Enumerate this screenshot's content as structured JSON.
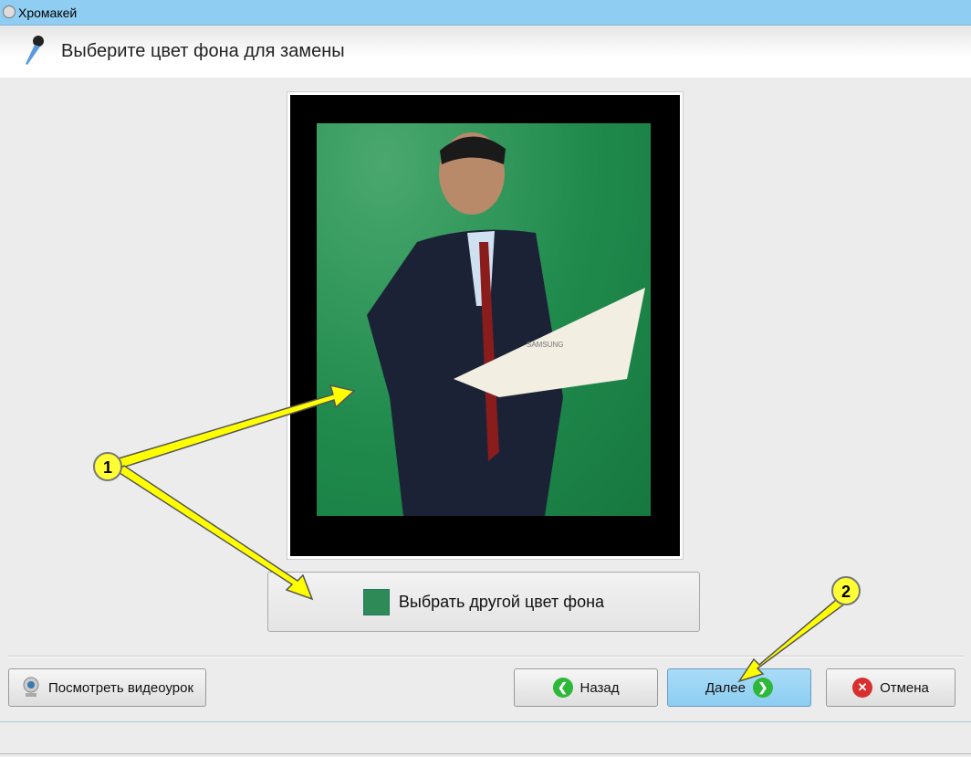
{
  "window": {
    "title": "Хромакей",
    "icon": "film-reel-icon"
  },
  "header": {
    "title": "Выберите цвет фона для замены",
    "icon": "pipette-icon"
  },
  "preview": {
    "background_color": "#1f8a4c",
    "photo_label": "SAMSUNG"
  },
  "color_button": {
    "label": "Выбрать другой цвет фона",
    "swatch_color": "#2e8b57"
  },
  "footer": {
    "video_button": "Посмотреть видеоурок",
    "back_button": "Назад",
    "next_button": "Далее",
    "cancel_button": "Отмена"
  },
  "annotations": {
    "badge1": "1",
    "badge2": "2"
  }
}
